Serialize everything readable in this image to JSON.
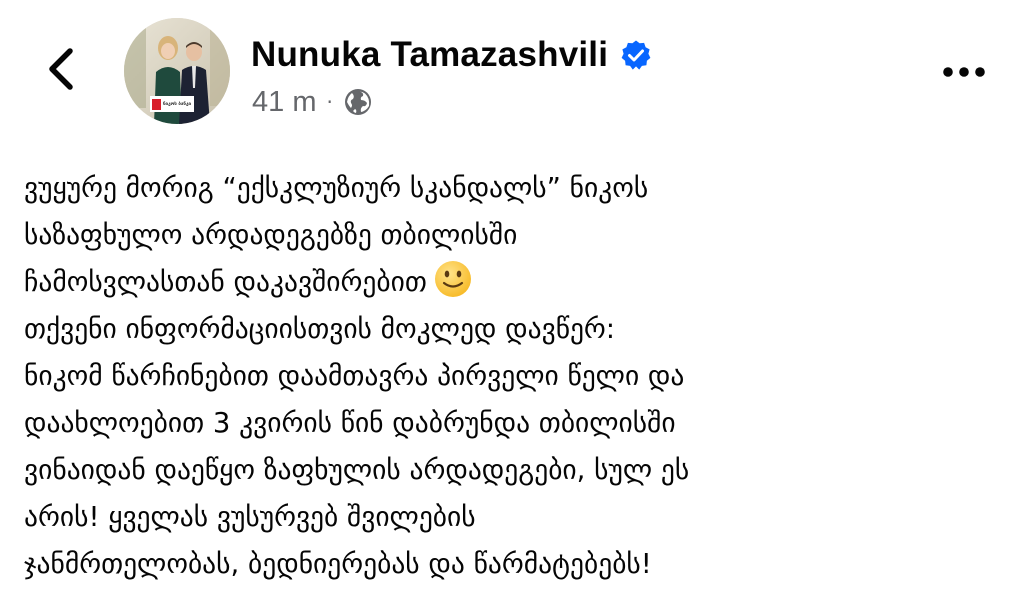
{
  "header": {
    "author_name": "Nunuka Tamazashvili",
    "timestamp": "41 m",
    "separator": "·",
    "verified": true,
    "audience_icon": "globe-icon",
    "avatar_badge_text": "ნიკოს ბანკი"
  },
  "colors": {
    "verified_blue": "#0866ff",
    "meta_gray": "#65676b",
    "text": "#050505"
  },
  "post": {
    "lines": [
      "ვუყურე მორიგ “ექსკლუზიურ სკანდალს” ნიკოს",
      "საზაფხულო არდადეგებზე თბილისში",
      "ჩამოსვლასთან დაკავშირებით",
      "თქვენი ინფორმაციისთვის მოკლედ დავწერ:",
      "ნიკომ წარჩინებით დაამთავრა პირველი წელი და",
      "დაახლოებით 3 კვირის წინ დაბრუნდა თბილისში",
      "ვინაიდან დაეწყო ზაფხულის არდადეგები, სულ ეს",
      "არის! ყველას ვუსურვებ შვილების",
      "ჯანმრთელობას, ბედნიერებას და წარმატებებს!"
    ],
    "emoji_after_line": 2,
    "emoji_icon": "slightly-smiling-face-icon"
  }
}
